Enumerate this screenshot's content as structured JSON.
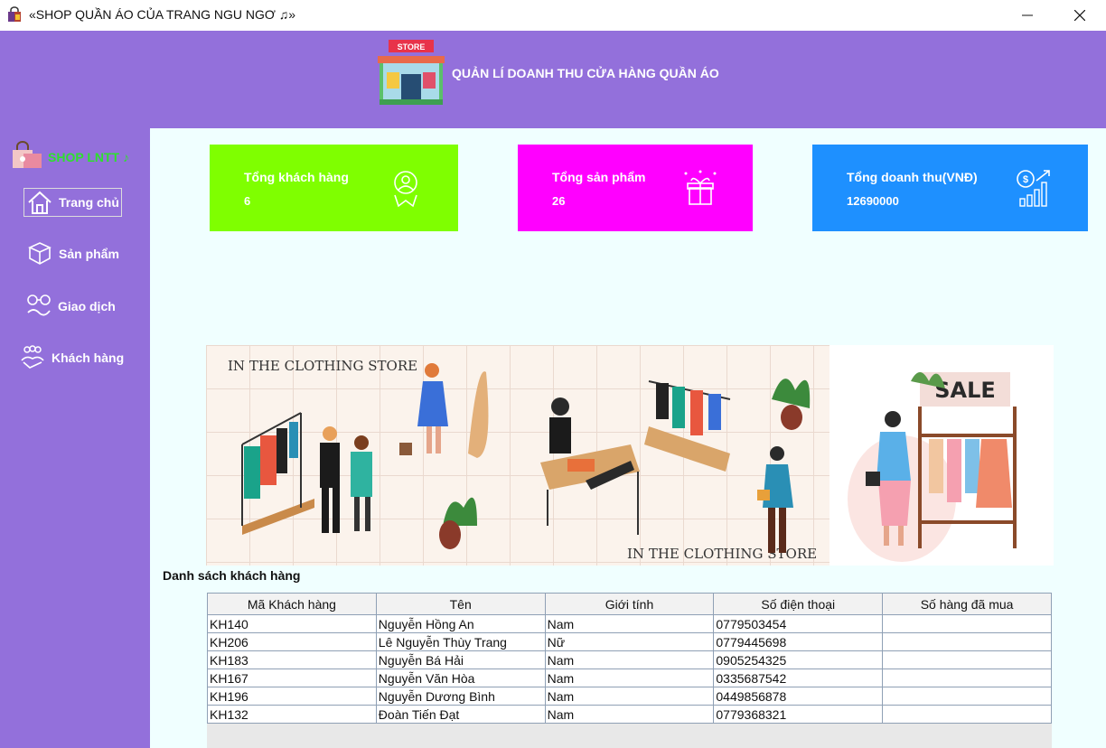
{
  "window": {
    "title": "«SHOP QUẦN ÁO CỦA TRANG NGU NGƠ ♫»",
    "minimize_icon": "minimize-icon",
    "maximize_icon": "maximize-icon",
    "close_icon": "close-icon"
  },
  "header": {
    "logo_text": "STORE",
    "title": "QUẢN LÍ DOANH THU CỬA HÀNG QUẦN ÁO"
  },
  "sidebar": {
    "brand": "SHOP LNTT ♪",
    "items": [
      {
        "label": "Trang chủ",
        "icon": "home-icon",
        "active": true
      },
      {
        "label": "Sản phẩm",
        "icon": "boxes-icon"
      },
      {
        "label": "Giao dịch",
        "icon": "transaction-icon"
      },
      {
        "label": "Khách hàng",
        "icon": "customers-icon"
      }
    ]
  },
  "cards": [
    {
      "label": "Tổng khách hàng",
      "value": "6",
      "color": "#7fff00",
      "icon": "customer-badge-icon"
    },
    {
      "label": "Tổng sản phẩm",
      "value": "26",
      "color": "#ff00ff",
      "icon": "gift-box-icon"
    },
    {
      "label": "Tổng doanh thu(VNĐ)",
      "value": "12690000",
      "color": "#1e90ff",
      "icon": "revenue-chart-icon"
    }
  ],
  "banner": {
    "caption_top": "IN THE CLOTHING STORE",
    "caption_bottom": "IN THE CLOTHING STORE",
    "sale_text": "SALE"
  },
  "customers": {
    "title": "Danh sách khách hàng",
    "columns": [
      "Mã Khách hàng",
      "Tên",
      "Giới tính",
      "Số điện thoại",
      "Số hàng đã mua"
    ],
    "rows": [
      [
        "KH140",
        "Nguyễn Hồng An",
        "Nam",
        "0779503454",
        ""
      ],
      [
        "KH206",
        "Lê Nguyễn Thùy Trang",
        "Nữ",
        "0779445698",
        ""
      ],
      [
        "KH183",
        "Nguyễn Bá Hải",
        "Nam",
        "0905254325",
        ""
      ],
      [
        "KH167",
        "Nguyễn Văn Hòa",
        "Nam",
        "0335687542",
        ""
      ],
      [
        "KH196",
        "Nguyễn Dương Bình",
        "Nam",
        "0449856878",
        ""
      ],
      [
        "KH132",
        "Đoàn Tiến Đạt",
        "Nam",
        "0779368321",
        ""
      ]
    ]
  },
  "colors": {
    "purple": "#9370db",
    "main_bg": "#f0ffff",
    "brand_green": "#2de02d"
  }
}
